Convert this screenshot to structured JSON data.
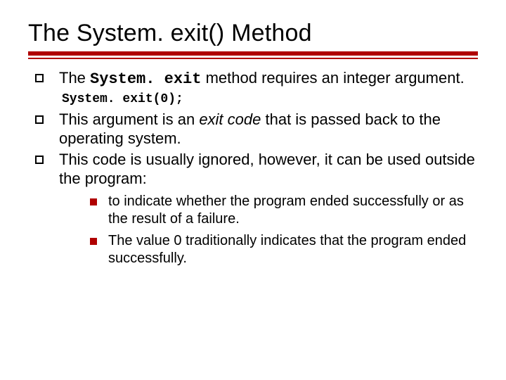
{
  "title": "The System. exit() Method",
  "bullets": {
    "b1_pre": "The ",
    "b1_code": "System. exit",
    "b1_post": " method requires an integer argument.",
    "code_line": "System. exit(0);",
    "b2_pre": "This argument is an ",
    "b2_em": "exit code",
    "b2_post": " that is passed back to the operating system.",
    "b3": "This code is usually ignored, however, it can be used outside the program:",
    "sub1": "to indicate whether the program ended successfully or as the result of a failure.",
    "sub2": "The value 0 traditionally indicates that the program ended successfully."
  }
}
